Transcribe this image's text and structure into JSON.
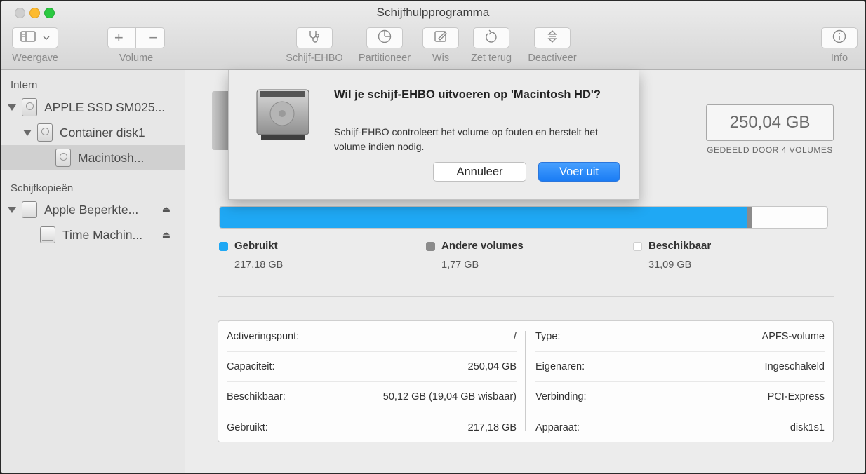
{
  "window": {
    "title": "Schijfhulpprogramma"
  },
  "toolbar": {
    "view_label": "Weergave",
    "volume_label": "Volume",
    "firstaid_label": "Schijf-EHBO",
    "partition_label": "Partitioneer",
    "erase_label": "Wis",
    "restore_label": "Zet terug",
    "unmount_label": "Deactiveer",
    "info_label": "Info"
  },
  "sidebar": {
    "section_internal": "Intern",
    "items_internal": [
      {
        "label": "APPLE SSD SM025..."
      },
      {
        "label": "Container disk1"
      },
      {
        "label": "Macintosh..."
      }
    ],
    "section_images": "Schijfkopieën",
    "items_images": [
      {
        "label": "Apple Beperkte..."
      },
      {
        "label": "Time Machin..."
      }
    ]
  },
  "main": {
    "capacity": "250,04 GB",
    "capacity_sub": "GEDEELD DOOR 4 VOLUMES",
    "usage": {
      "used_fraction": 0.8686,
      "other_fraction": 0.0071,
      "colors": {
        "used": "#1fa8f4",
        "other": "#8b8b8b",
        "free": "#ffffff"
      }
    },
    "legend": [
      {
        "name": "Gebruikt",
        "value": "217,18 GB"
      },
      {
        "name": "Andere volumes",
        "value": "1,77 GB"
      },
      {
        "name": "Beschikbaar",
        "value": "31,09 GB"
      }
    ],
    "info_left": [
      {
        "k": "Activeringspunt:",
        "v": "/"
      },
      {
        "k": "Capaciteit:",
        "v": "250,04 GB"
      },
      {
        "k": "Beschikbaar:",
        "v": "50,12 GB (19,04 GB wisbaar)"
      },
      {
        "k": "Gebruikt:",
        "v": "217,18 GB"
      }
    ],
    "info_right": [
      {
        "k": "Type:",
        "v": "APFS-volume"
      },
      {
        "k": "Eigenaren:",
        "v": "Ingeschakeld"
      },
      {
        "k": "Verbinding:",
        "v": "PCI-Express"
      },
      {
        "k": "Apparaat:",
        "v": "disk1s1"
      }
    ]
  },
  "dialog": {
    "title": "Wil je schijf-EHBO uitvoeren op 'Macintosh HD'?",
    "message": "Schijf-EHBO controleert het volume op fouten en herstelt het volume indien nodig.",
    "cancel_label": "Annuleer",
    "ok_label": "Voer uit"
  }
}
